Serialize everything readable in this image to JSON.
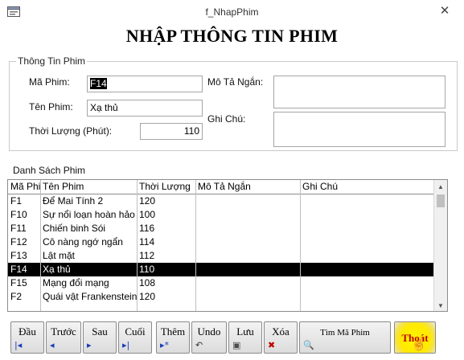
{
  "window": {
    "title": "f_NhapPhim",
    "close_label": "✕"
  },
  "form_title": "NHẬP THÔNG TIN PHIM",
  "group": {
    "title": "Thông Tin Phim",
    "ma_phim_label": "Mã Phim:",
    "ma_phim_value": "F14",
    "ten_phim_label": "Tên Phim:",
    "ten_phim_value": "Xạ thủ",
    "thoi_luong_label": "Thời Lượng (Phút):",
    "thoi_luong_value": "110",
    "mo_ta_label": "Mô Tả Ngắn:",
    "mo_ta_value": "",
    "ghi_chu_label": "Ghi Chú:",
    "ghi_chu_value": ""
  },
  "list": {
    "label": "Danh Sách Phim",
    "columns": [
      "Mã Phim",
      "Tên Phim",
      "Thời Lượng",
      "Mô Tả Ngắn",
      "Ghi Chú"
    ],
    "rows": [
      [
        "F1",
        "Để Mai Tính 2",
        "120",
        "",
        ""
      ],
      [
        "F10",
        "Sự nổi loạn hoàn hảo",
        "100",
        "",
        ""
      ],
      [
        "F11",
        "Chiến binh Sói",
        "116",
        "",
        ""
      ],
      [
        "F12",
        "Cô nàng ngớ ngẩn",
        "114",
        "",
        ""
      ],
      [
        "F13",
        "Lật mặt",
        "112",
        "",
        ""
      ],
      [
        "F14",
        "Xạ thủ",
        "110",
        "",
        ""
      ],
      [
        "F15",
        "Mạng đổi mạng",
        "108",
        "",
        ""
      ],
      [
        "F2",
        "Quái vật Frankenstein",
        "120",
        "",
        ""
      ]
    ],
    "selected_row": 5
  },
  "buttons": {
    "dau": "Đầu",
    "truoc": "Trước",
    "sau": "Sau",
    "cuoi": "Cuối",
    "them": "Thêm",
    "undo": "Undo",
    "luu": "Lưu",
    "xoa": "Xóa",
    "tim_ma_phim": "Tìm Mã Phim",
    "thoat": "Thoát"
  },
  "icons": {
    "app": "form-icon",
    "dau": "first-record-icon",
    "truoc": "previous-record-icon",
    "sau": "next-record-icon",
    "cuoi": "last-record-icon",
    "them": "new-record-icon",
    "undo": "undo-icon",
    "luu": "save-icon",
    "xoa": "delete-icon",
    "tim": "find-icon",
    "cursor": "hand-cursor-icon"
  },
  "colors": {
    "accent_yellow": "#ffea00",
    "exit_text": "#c10000",
    "nav_icon": "#1a3db8"
  }
}
